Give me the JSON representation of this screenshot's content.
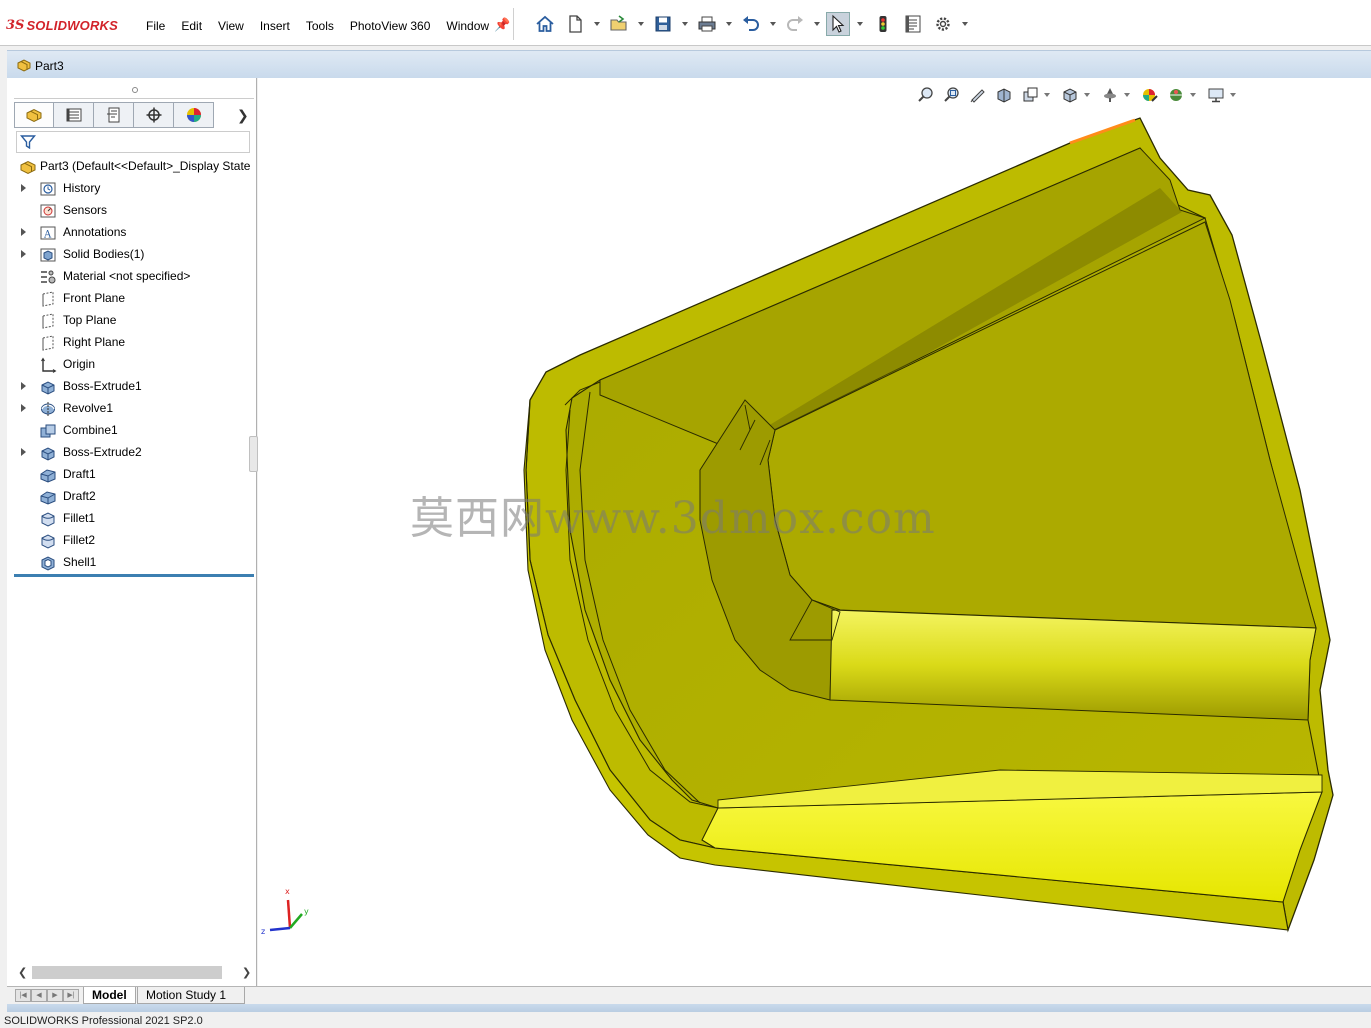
{
  "app": {
    "logo_ds": "3S",
    "logo_text": "SOLIDWORKS"
  },
  "menu": [
    "File",
    "Edit",
    "View",
    "Insert",
    "Tools",
    "PhotoView 360",
    "Window"
  ],
  "document": {
    "title": "Part3"
  },
  "tree": {
    "root": "Part3  (Default<<Default>_Display State",
    "items": [
      {
        "label": "History",
        "icon": "history-icon",
        "expandable": true
      },
      {
        "label": "Sensors",
        "icon": "sensors-icon",
        "expandable": false
      },
      {
        "label": "Annotations",
        "icon": "annotations-icon",
        "expandable": true
      },
      {
        "label": "Solid Bodies(1)",
        "icon": "solid-bodies-icon",
        "expandable": true
      },
      {
        "label": "Material <not specified>",
        "icon": "material-icon",
        "expandable": false
      },
      {
        "label": "Front Plane",
        "icon": "plane-icon",
        "expandable": false
      },
      {
        "label": "Top Plane",
        "icon": "plane-icon",
        "expandable": false
      },
      {
        "label": "Right Plane",
        "icon": "plane-icon",
        "expandable": false
      },
      {
        "label": "Origin",
        "icon": "origin-icon",
        "expandable": false
      },
      {
        "label": "Boss-Extrude1",
        "icon": "extrude-icon",
        "expandable": true
      },
      {
        "label": "Revolve1",
        "icon": "revolve-icon",
        "expandable": true
      },
      {
        "label": "Combine1",
        "icon": "combine-icon",
        "expandable": false
      },
      {
        "label": "Boss-Extrude2",
        "icon": "extrude-icon",
        "expandable": true
      },
      {
        "label": "Draft1",
        "icon": "draft-icon",
        "expandable": false
      },
      {
        "label": "Draft2",
        "icon": "draft-icon",
        "expandable": false
      },
      {
        "label": "Fillet1",
        "icon": "fillet-icon",
        "expandable": false
      },
      {
        "label": "Fillet2",
        "icon": "fillet-icon",
        "expandable": false
      },
      {
        "label": "Shell1",
        "icon": "shell-icon",
        "expandable": false
      }
    ]
  },
  "viewport": {
    "watermark": "莫西网www.3dmox.com",
    "model_color": "#c8c800",
    "triad": {
      "x": "x",
      "y": "y",
      "z": "z"
    }
  },
  "bottom_tabs": {
    "model": "Model",
    "motion": "Motion Study 1"
  },
  "status": {
    "text": "SOLIDWORKS Professional 2021 SP2.0"
  },
  "colors": {
    "brand": "#d2232a",
    "part_face": "#b5b500",
    "part_light": "#eded1a",
    "rollback_bar": "#3c7fb1"
  }
}
